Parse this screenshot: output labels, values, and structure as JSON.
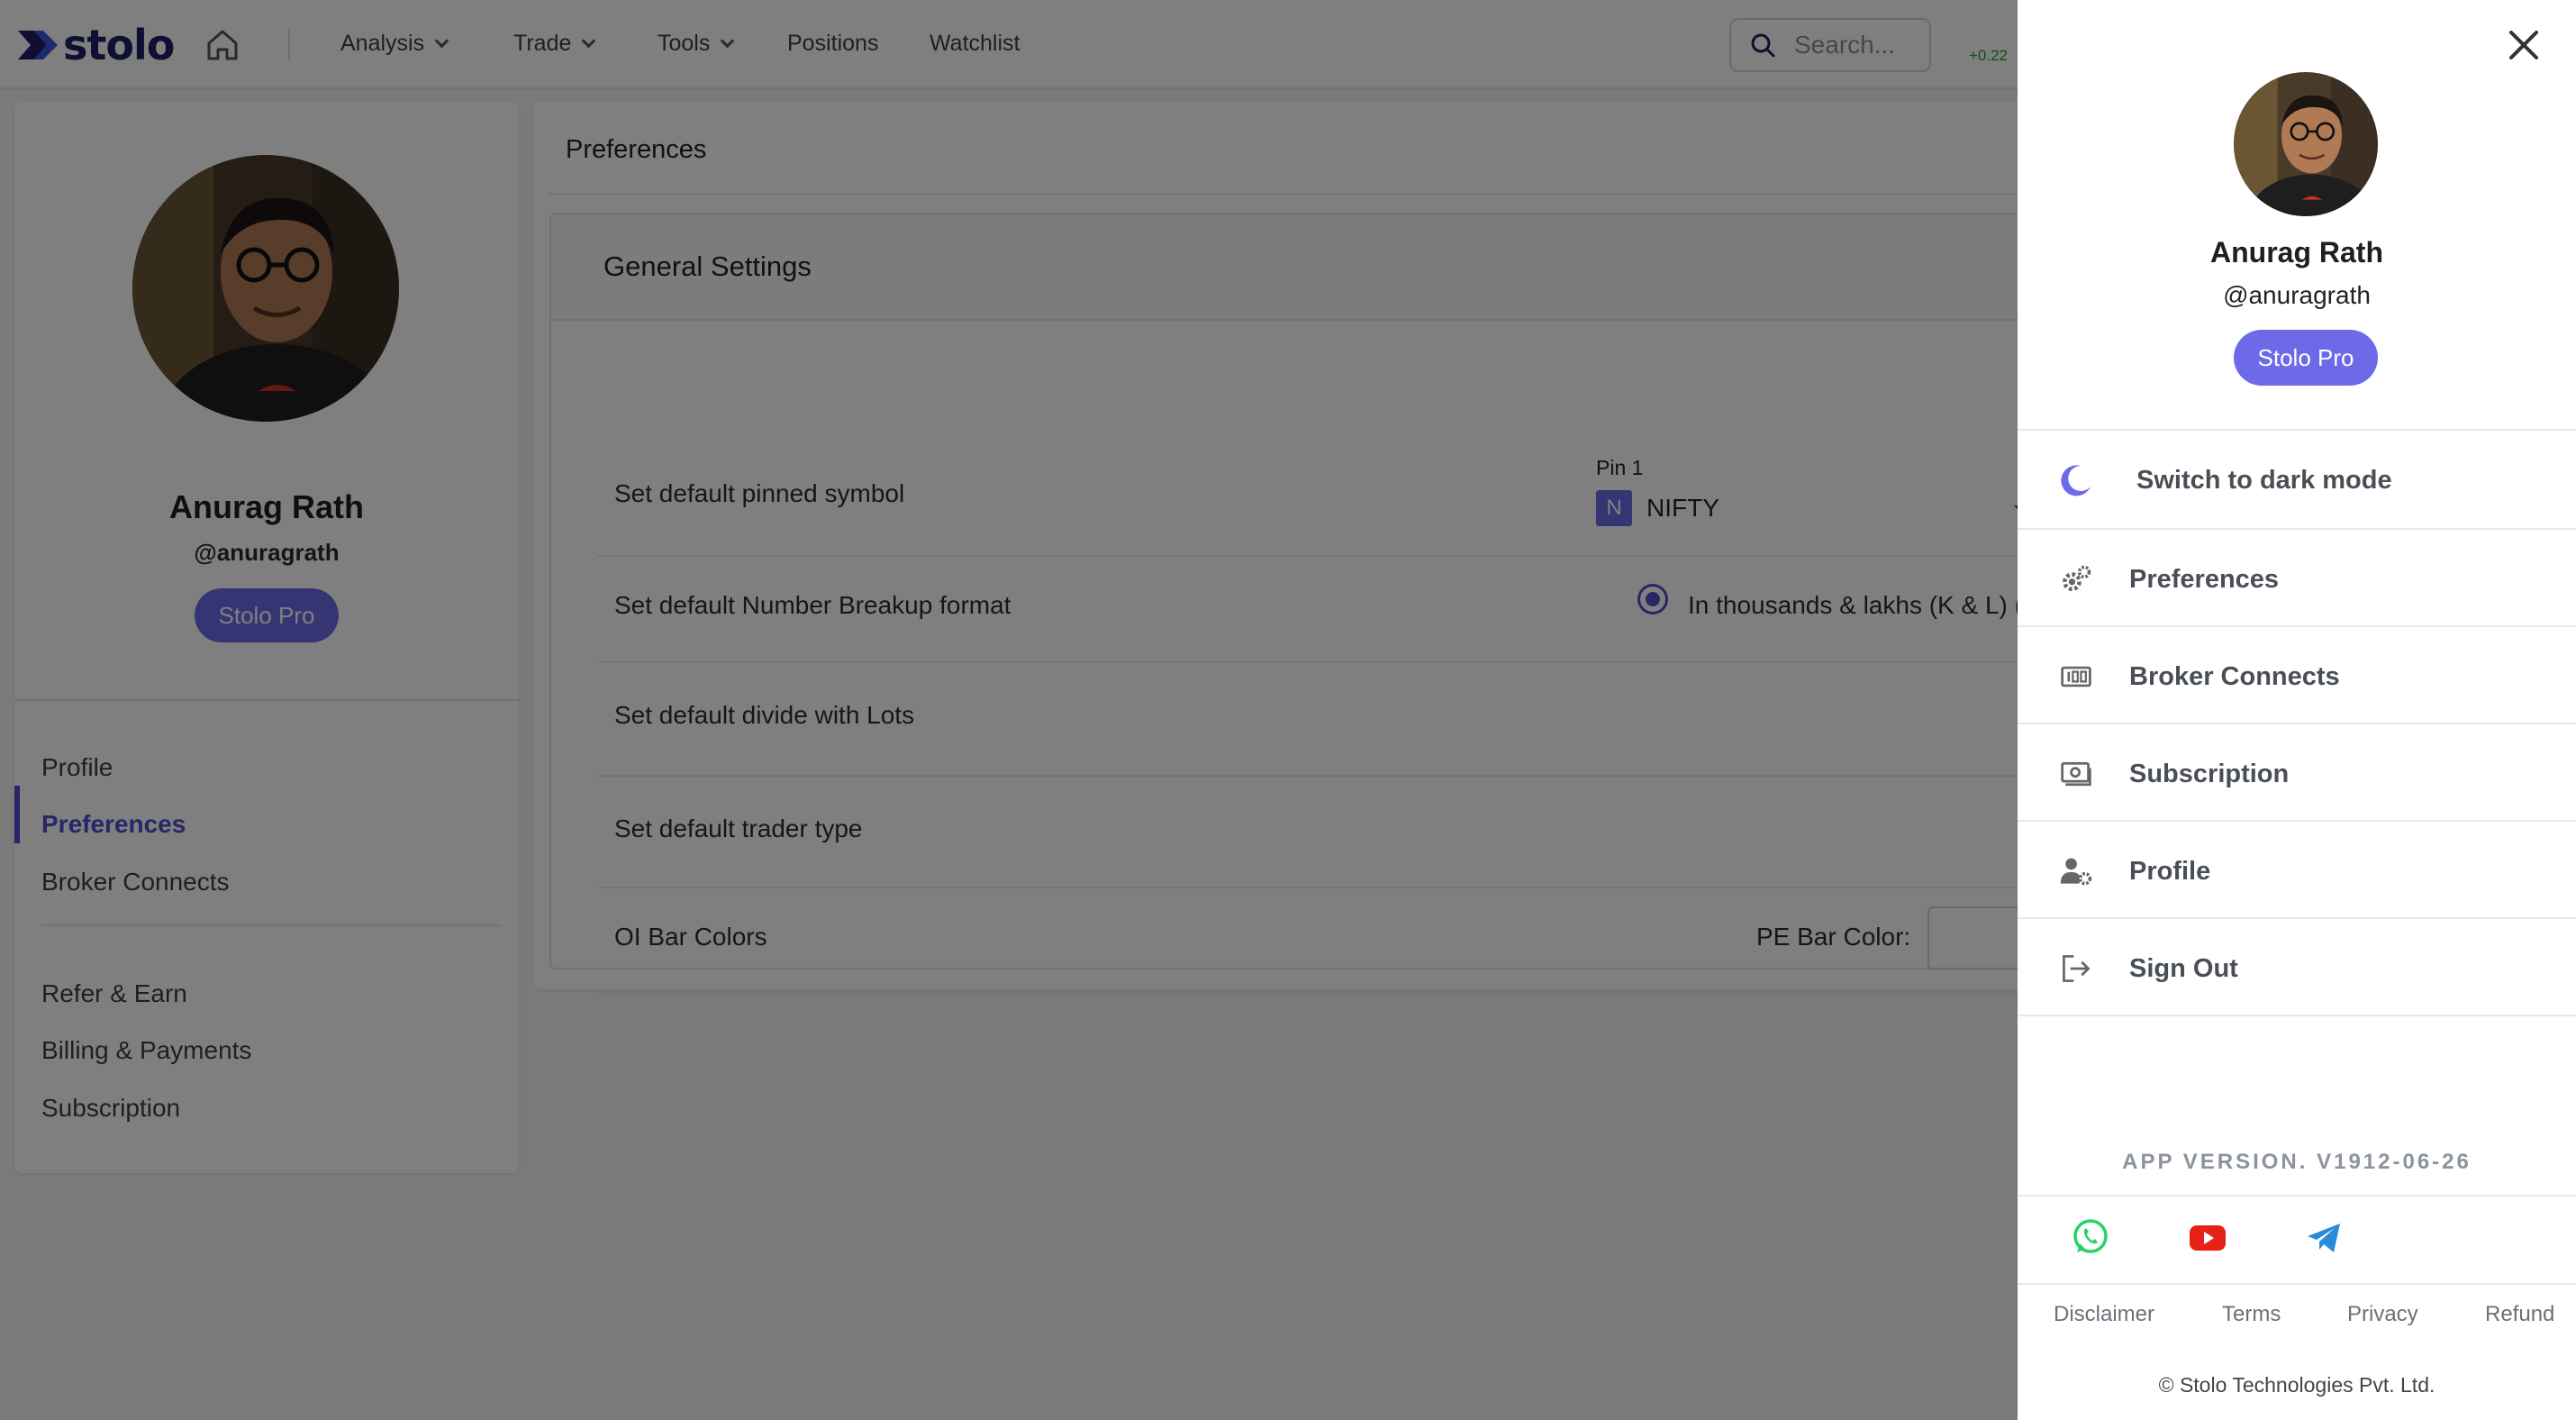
{
  "brand": {
    "name": "stolo"
  },
  "nav": {
    "items": [
      {
        "label": "Analysis",
        "dropdown": true
      },
      {
        "label": "Trade",
        "dropdown": true
      },
      {
        "label": "Tools",
        "dropdown": true
      },
      {
        "label": "Positions",
        "dropdown": false
      },
      {
        "label": "Watchlist",
        "dropdown": false
      }
    ],
    "search_placeholder": "Search...",
    "ticker_fragment": "+0.22"
  },
  "sidebar": {
    "name": "Anurag Rath",
    "handle": "@anuragrath",
    "badge": "Stolo Pro",
    "links": [
      {
        "label": "Profile",
        "active": false
      },
      {
        "label": "Preferences",
        "active": true
      },
      {
        "label": "Broker Connects",
        "active": false
      }
    ],
    "links2": [
      {
        "label": "Refer & Earn"
      },
      {
        "label": "Billing & Payments"
      },
      {
        "label": "Subscription"
      }
    ]
  },
  "main": {
    "title": "Preferences",
    "section_title": "General Settings",
    "rows": [
      {
        "label": "Set default pinned symbol"
      },
      {
        "label": "Set default Number Breakup format"
      },
      {
        "label": "Set default divide with Lots"
      },
      {
        "label": "Set default trader type"
      },
      {
        "label": "OI Bar Colors"
      }
    ],
    "pin": {
      "label": "Pin 1",
      "tag": "N",
      "value": "NIFTY"
    },
    "number_format": {
      "option": "In thousands & lakhs (K & L) (",
      "selected": true
    },
    "pe_bar_color_label": "PE Bar Color:"
  },
  "drawer": {
    "name": "Anurag Rath",
    "handle": "@anuragrath",
    "badge": "Stolo Pro",
    "dark_mode_label": "Switch to dark mode",
    "menu": [
      {
        "label": "Preferences",
        "icon": "gears-icon"
      },
      {
        "label": "Broker Connects",
        "icon": "broker-icon"
      },
      {
        "label": "Subscription",
        "icon": "subscription-icon"
      },
      {
        "label": "Profile",
        "icon": "user-cog-icon"
      },
      {
        "label": "Sign Out",
        "icon": "sign-out-icon"
      }
    ],
    "version": "APP VERSION. V1912-06-26",
    "footer_links": [
      "Disclaimer",
      "Terms",
      "Privacy",
      "Refund"
    ],
    "copyright": "© Stolo Technologies Pvt. Ltd."
  },
  "colors": {
    "accent": "#6c6ae8",
    "accent_dark": "#4f4dd1",
    "whatsapp": "#25d366",
    "youtube": "#e62117",
    "telegram": "#2a8bd8",
    "overlay": "rgba(0,0,0,0.5)"
  }
}
